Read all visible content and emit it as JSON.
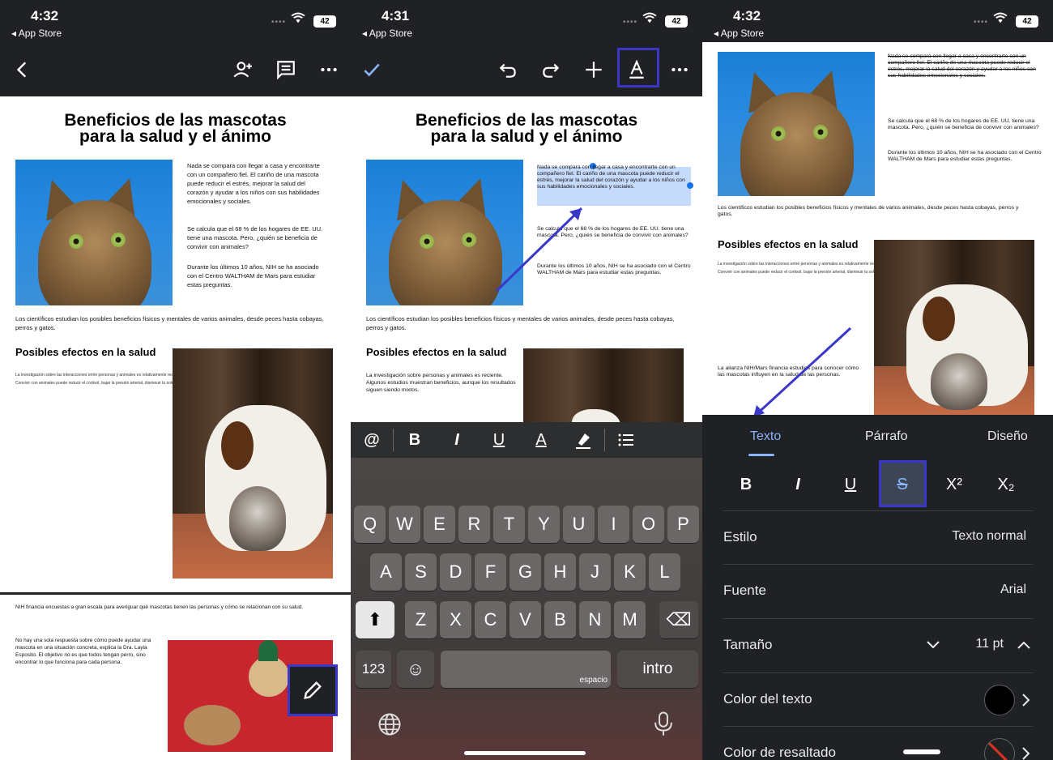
{
  "status": {
    "p1_time": "4:32",
    "p2_time": "4:31",
    "p3_time": "4:32",
    "back_app": "App Store",
    "battery": "42"
  },
  "doc": {
    "title_line1": "Beneficios de las mascotas",
    "title_line2": "para la salud y el ánimo",
    "para1": "Nada se compara con llegar a casa y encontrarte con un compañero fiel. El cariño de una mascota puede reducir el estrés, mejorar la salud del corazón y ayudar a los niños con sus habilidades emocionales y sociales.",
    "para2": "Se calcula que el 68 % de los hogares de EE. UU. tiene una mascota. Pero, ¿quién se beneficia de convivir con animales?",
    "para3": "Durante los últimos 10 años, NIH se ha asociado con el Centro WALTHAM de Mars para estudiar estas preguntas.",
    "para4": "Los científicos estudian los posibles beneficios físicos y mentales de varios animales, desde peces hasta cobayas, perros y gatos.",
    "heading2": "Posibles efectos en la salud",
    "small1": "La investigación sobre las interacciones entre personas y animales es relativamente reciente.",
    "small2": "Convivir con animales puede reducir el cortisol, bajar la presión arterial, disminuir la soledad.",
    "para5": "La investigación sobre personas y animales es reciente. Algunos estudios muestran beneficios, aunque los resultados siguen siendo mixtos.",
    "para6": "La alianza NIH/Mars financia estudios para conocer cómo las mascotas influyen en la salud de las personas.",
    "para7": "NIH financia encuestas a gran escala para averiguar qué mascotas tienen las personas y cómo se relacionan con su salud.",
    "para8": "No hay una sola respuesta sobre cómo puede ayudar una mascota en una situación concreta, explica la Dra. Layla Esposito. El objetivo no es que todos tengan perro, sino encontrar lo que funciona para cada persona."
  },
  "keyboard": {
    "row1": [
      "Q",
      "W",
      "E",
      "R",
      "T",
      "Y",
      "U",
      "I",
      "O",
      "P"
    ],
    "row2": [
      "A",
      "S",
      "D",
      "F",
      "G",
      "H",
      "J",
      "K",
      "L"
    ],
    "row3": [
      "Z",
      "X",
      "C",
      "V",
      "B",
      "N",
      "M"
    ],
    "numbers": "123",
    "space": "espacio",
    "enter": "intro"
  },
  "panel": {
    "tabs": [
      "Texto",
      "Párrafo",
      "Diseño"
    ],
    "style_label": "Estilo",
    "style_value": "Texto normal",
    "font_label": "Fuente",
    "font_value": "Arial",
    "size_label": "Tamaño",
    "size_value": "11 pt",
    "text_color_label": "Color del texto",
    "highlight_label": "Color de resaltado",
    "text_color": "#000000"
  },
  "colors": {
    "toolbar_bg": "#202124",
    "accent_blue": "#8ab4f8",
    "callout_border": "#3b37c8",
    "selection": "#c6dafc"
  }
}
